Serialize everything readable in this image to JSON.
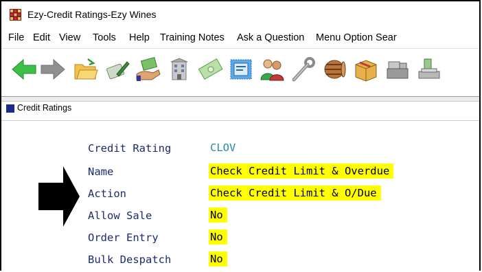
{
  "window": {
    "title": "Ezy-Credit Ratings-Ezy Wines"
  },
  "menu": [
    "File",
    "Edit",
    "View",
    "Tools",
    "Help",
    "Training Notes",
    "Ask a Question",
    "Menu Option Sear"
  ],
  "toolbar": {
    "buttons": [
      {
        "icon": "back-arrow-icon"
      },
      {
        "icon": "forward-arrow-icon"
      },
      {
        "icon": "open-folder-icon"
      },
      {
        "icon": "pen-notes-icon"
      },
      {
        "icon": "hand-money-icon"
      },
      {
        "icon": "building-icon"
      },
      {
        "icon": "cheque-icon"
      },
      {
        "icon": "stamp-icon"
      },
      {
        "icon": "people-icon"
      },
      {
        "icon": "wrench-icon"
      },
      {
        "icon": "barrel-icon"
      },
      {
        "icon": "box-icon"
      },
      {
        "icon": "cash-register-icon"
      },
      {
        "icon": "money-stack-icon"
      }
    ]
  },
  "form": {
    "header": "Credit Ratings",
    "fields": [
      {
        "label": "Credit Rating",
        "value": "CLOV"
      },
      {
        "label": "Name",
        "value": "Check Credit Limit & Overdue"
      },
      {
        "label": "Action",
        "value": "Check Credit Limit & O/Due"
      },
      {
        "label": "Allow Sale",
        "value": "No"
      },
      {
        "label": "Order Entry",
        "value": "No"
      },
      {
        "label": "Bulk Despatch",
        "value": "No"
      }
    ]
  },
  "colors": {
    "highlight": "#ffff00",
    "label": "#1c2a6e",
    "code_value": "#1e8ea0"
  }
}
